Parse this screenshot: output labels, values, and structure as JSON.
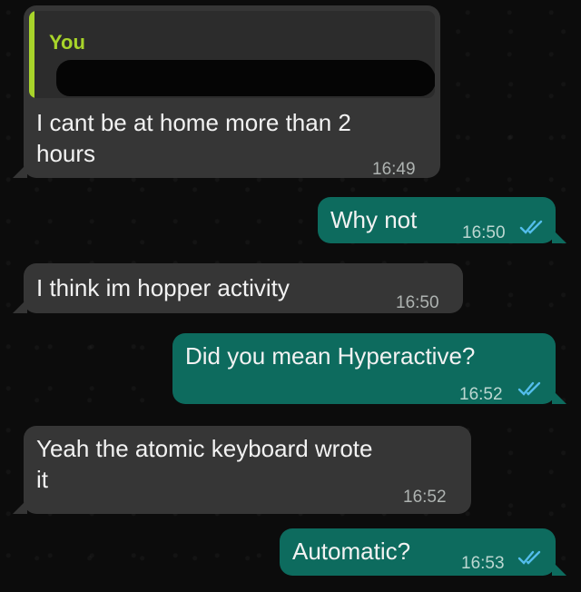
{
  "messages": [
    {
      "id": "m1",
      "direction": "incoming",
      "quote_author": "You",
      "text": "I cant be at home more than 2\nhours",
      "time": "16:49"
    },
    {
      "id": "m2",
      "direction": "outgoing",
      "text": "Why not",
      "time": "16:50",
      "status": "read"
    },
    {
      "id": "m3",
      "direction": "incoming",
      "text": "I think im hopper activity",
      "time": "16:50"
    },
    {
      "id": "m4",
      "direction": "outgoing",
      "text": "Did you mean Hyperactive?",
      "time": "16:52",
      "status": "read"
    },
    {
      "id": "m5",
      "direction": "incoming",
      "text": "Yeah the atomic  keyboard wrote\nit",
      "time": "16:52"
    },
    {
      "id": "m6",
      "direction": "outgoing",
      "text": "Automatic?",
      "time": "16:53",
      "status": "read"
    }
  ],
  "colors": {
    "incoming_bubble": "#363636",
    "outgoing_bubble": "#0d6b5e",
    "quote_accent": "#a8d42a",
    "read_ticks": "#53bdeb"
  },
  "icons": {
    "read_receipt": "double-check-icon"
  }
}
